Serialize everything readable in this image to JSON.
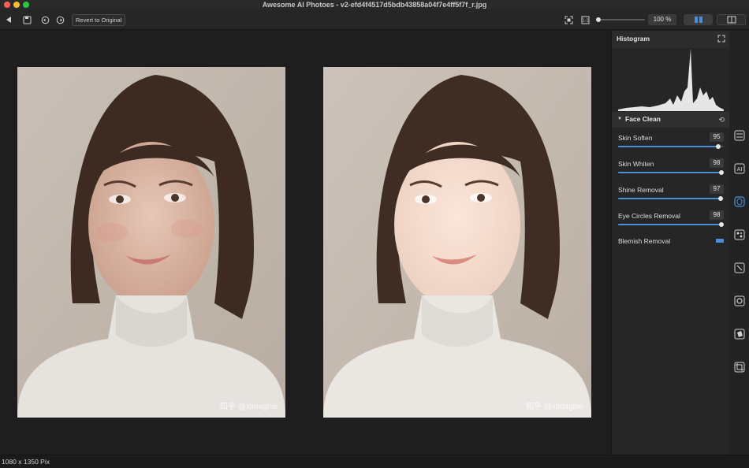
{
  "window": {
    "title": "Awesome AI Photoes   - v2-efd4f4517d5bdb43858a04f7e4ff5f7f_r.jpg"
  },
  "toolbar": {
    "revert_label": "Revert to Original",
    "zoom_value": "100 %",
    "zoom_level": 0.0
  },
  "canvas": {
    "watermark_left": "知乎 @ximagine",
    "watermark_right": "知乎 @ximagine"
  },
  "panel": {
    "histogram_title": "Histogram",
    "section_title": "Face Clean",
    "sliders": [
      {
        "label": "Skin Soften",
        "value": "95",
        "level": 0.95
      },
      {
        "label": "Skin Whiten",
        "value": "98",
        "level": 0.98
      },
      {
        "label": "Shine Removal",
        "value": "97",
        "level": 0.97
      },
      {
        "label": "Eye Circles Removal",
        "value": "98",
        "level": 0.98
      }
    ],
    "toggle_label": "Blemish Removal"
  },
  "rail": {
    "icons": [
      "adjustments-icon",
      "ai-icon",
      "face-clean-icon",
      "effects-icon",
      "retouch-icon",
      "settings-icon",
      "layers-icon",
      "crop-icon"
    ]
  },
  "status": {
    "dimensions": "1080 x 1350 Pix"
  },
  "colors": {
    "accent": "#4a8fd9",
    "background": "#1e1e1e",
    "panel": "#262626"
  }
}
